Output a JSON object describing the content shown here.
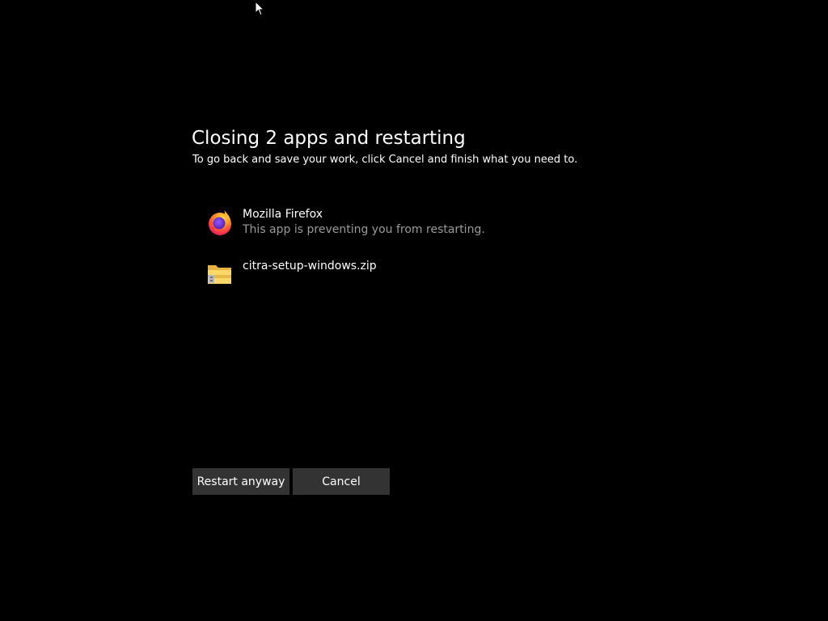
{
  "dialog": {
    "title": "Closing 2 apps and restarting",
    "subtitle": "To go back and save your work, click Cancel and finish what you need to."
  },
  "apps": [
    {
      "name": "Mozilla Firefox",
      "status": "This app is preventing you from restarting.",
      "icon": "firefox-icon"
    },
    {
      "name": "citra-setup-windows.zip",
      "status": "",
      "icon": "zip-folder-icon"
    }
  ],
  "buttons": {
    "restart_label": "Restart anyway",
    "cancel_label": "Cancel"
  },
  "colors": {
    "background": "#000000",
    "button_bg": "#333333",
    "status_text": "#9a9a9a"
  }
}
